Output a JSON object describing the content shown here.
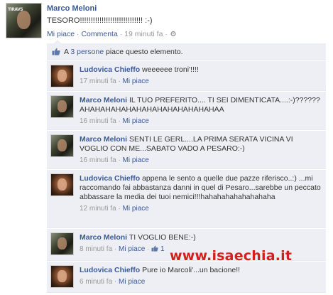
{
  "post": {
    "author": "Marco Meloni",
    "text": "TESORO!!!!!!!!!!!!!!!!!!!!!!!!!!!!! :-)",
    "like_link": "Mi piace",
    "comment_link": "Commenta",
    "separator": "·",
    "time": "19 minuti fa",
    "avatar_tag": "TIRAVS"
  },
  "likes": {
    "prefix": "A",
    "count_link": "3 persone",
    "suffix": "piace questo elemento."
  },
  "comments": [
    {
      "author": "Ludovica Chieffo",
      "text": "weeeeee troni'!!!!",
      "time": "17 minuti fa",
      "like_link": "Mi piace"
    },
    {
      "author": "Marco Meloni",
      "text": "IL TUO PREFERITO.... TI SEI DIMENTICATA....:-)?????? AHAHAHAHAHAHAHAHAHAHAHAHAHAA",
      "time": "16 minuti fa",
      "like_link": "Mi piace"
    },
    {
      "author": "Marco Meloni",
      "text": "SENTI LE GERL....LA PRIMA SERATA VICINA VI VOGLIO CON ME...SABATO VADO A PESARO:-)",
      "time": "16 minuti fa",
      "like_link": "Mi piace"
    },
    {
      "author": "Ludovica Chieffo",
      "text": "appena le sento a quelle due pazze riferisco..:) ...mi raccomando fai abbastanza danni in quel di Pesaro...sarebbe un peccato abbassare la media dei tuoi nemici!!!hahahahahahahahaha",
      "time": "12 minuti fa",
      "like_link": "Mi piace"
    },
    {
      "author": "Marco Meloni",
      "text": "TI VOGLIO BENE:-)",
      "time": "8 minuti fa",
      "like_link": "Mi piace",
      "like_count": "1"
    },
    {
      "author": "Ludovica Chieffo",
      "text": "Pure io Marcoli'...un bacione!!",
      "time": "6 minuti fa",
      "like_link": "Mi piace"
    }
  ],
  "watermark": "www.isaechia.it",
  "colors": {
    "link": "#3b5998",
    "comment_bg": "#edeff4",
    "meta": "#999999",
    "watermark": "#d1201d"
  }
}
